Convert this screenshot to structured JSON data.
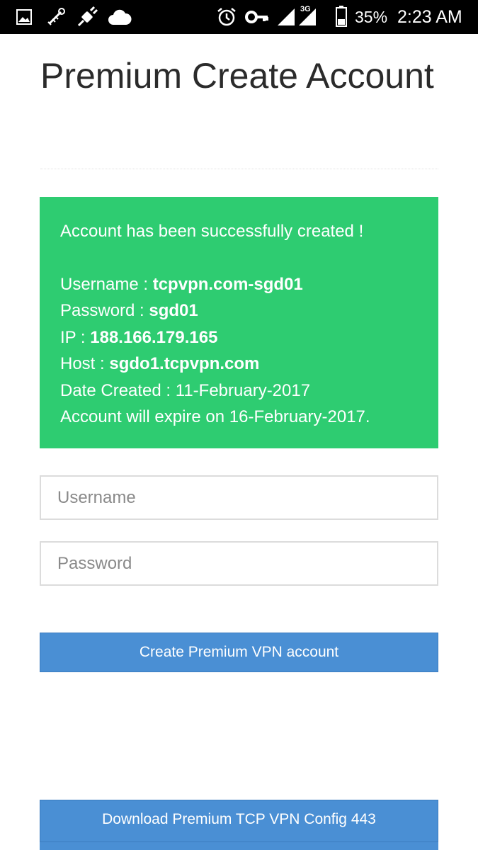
{
  "status_bar": {
    "icons": [
      "image-icon",
      "usb-debug-icon",
      "vpn-plug-icon",
      "cloud-icon",
      "alarm-icon",
      "key-icon",
      "wifi-signal-icon",
      "mobile-signal-icon",
      "battery-icon"
    ],
    "network_label": "3G",
    "battery_percent": "35%",
    "time": "2:23 AM"
  },
  "page": {
    "title": "Premium Create Account"
  },
  "alert": {
    "color": "#2ecc71",
    "message": "Account has been successfully created !",
    "username_label": "Username : ",
    "username_value": "tcpvpn.com-sgd01",
    "password_label": "Password : ",
    "password_value": "sgd01",
    "ip_label": "IP : ",
    "ip_value": "188.166.179.165",
    "host_label": "Host : ",
    "host_value": "sgdo1.tcpvpn.com",
    "date_created": "Date Created : 11-February-2017",
    "expire": "Account will expire on 16-February-2017."
  },
  "form": {
    "username_placeholder": "Username",
    "username_value": "",
    "password_placeholder": "Password",
    "password_value": "",
    "submit_label": "Create Premium VPN account"
  },
  "download": {
    "config_label": "Download Premium TCP VPN Config 443"
  },
  "colors": {
    "button": "#4a8fd4",
    "success": "#2ecc71"
  }
}
